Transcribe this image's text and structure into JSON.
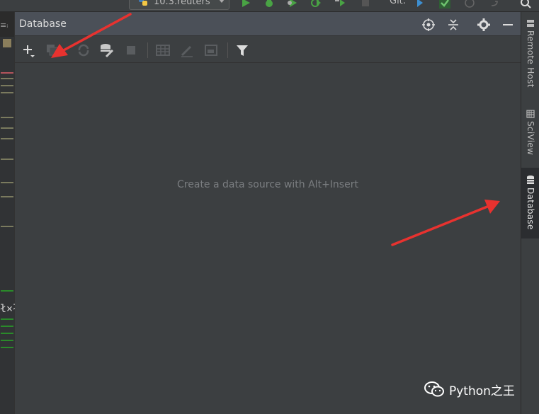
{
  "top_toolbar": {
    "run_config_label": "10.3.reuters",
    "git_label": "Git:"
  },
  "database_panel": {
    "title": "Database",
    "empty_message": "Create a data source with Alt+Insert",
    "header_icons": [
      "target-icon",
      "collapse-icon",
      "gear-icon",
      "minimize-icon"
    ],
    "toolbar_icons": [
      "add-icon",
      "duplicate-icon",
      "refresh-icon",
      "data-source-properties-icon",
      "stop-icon",
      "table-icon",
      "edit-icon",
      "console-icon",
      "filter-icon"
    ]
  },
  "right_strip": {
    "tabs": [
      {
        "label": "Remote Host",
        "icon": "server-icon",
        "active": false
      },
      {
        "label": "SciView",
        "icon": "grid-icon",
        "active": false
      },
      {
        "label": "Database",
        "icon": "database-icon",
        "active": true
      }
    ]
  },
  "left_strip": {
    "fragment": "≡ᵢ",
    "code_fragment": "ł×ł"
  },
  "watermark": {
    "text": "Python之王"
  },
  "colors": {
    "annotation_arrow": "#e8322f",
    "panel_bg": "#3c3f41",
    "header_bg": "#4b5058",
    "run_green": "#49a344"
  }
}
